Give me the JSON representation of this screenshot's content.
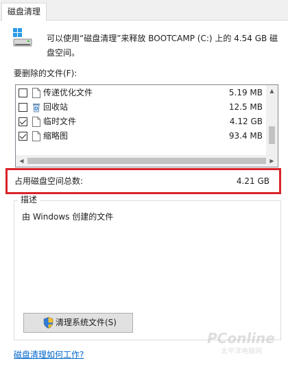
{
  "tab": {
    "label": "磁盘清理"
  },
  "header": {
    "text": "可以使用“磁盘清理”来释放 BOOTCAMP (C:) 上的 4.54 GB 磁盘空间。"
  },
  "files_label": "要删除的文件(F):",
  "files": [
    {
      "name": "传递优化文件",
      "size": "5.19 MB",
      "checked": false,
      "icon": "file-icon"
    },
    {
      "name": "回收站",
      "size": "12.5 MB",
      "checked": false,
      "icon": "recycle-bin-icon"
    },
    {
      "name": "临时文件",
      "size": "4.12 GB",
      "checked": true,
      "icon": "file-icon"
    },
    {
      "name": "缩略图",
      "size": "93.4 MB",
      "checked": true,
      "icon": "file-icon"
    }
  ],
  "total": {
    "label": "占用磁盘空间总数:",
    "value": "4.21 GB",
    "highlight_color": "#d8232a"
  },
  "description": {
    "legend": "描述",
    "text": "由 Windows 创建的文件"
  },
  "cleanup_button": {
    "label": "清理系统文件(S)",
    "icon": "uac-shield-icon"
  },
  "help_link": {
    "label": "磁盘清理如何工作?"
  },
  "watermark": {
    "line1": "PConline",
    "line2": "太平洋电脑网"
  }
}
